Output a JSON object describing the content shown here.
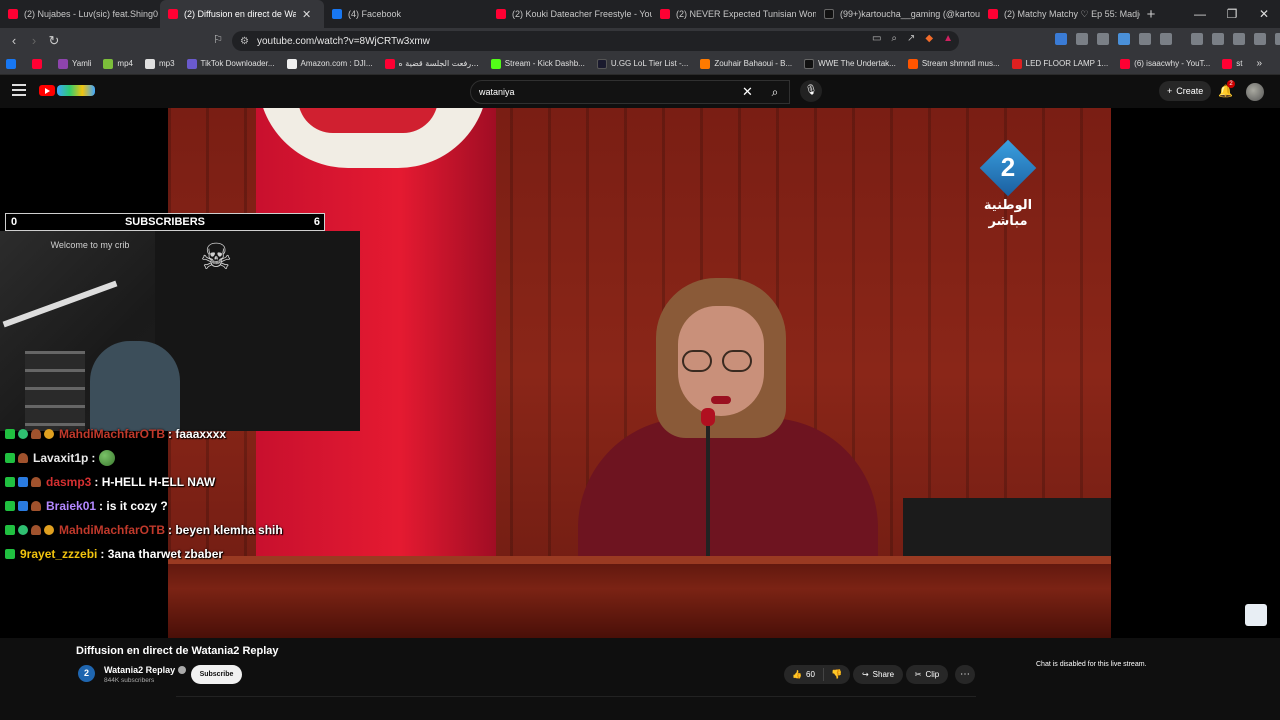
{
  "browser": {
    "tabs": [
      {
        "title": "(2) Nujabes - Luv(sic) feat.Shing0",
        "color": "#ff0033",
        "active": false
      },
      {
        "title": "(2) Diffusion en direct de Wat",
        "color": "#ff0033",
        "active": true
      },
      {
        "title": "(4) Facebook",
        "color": "#1877f2",
        "active": false
      },
      {
        "title": "(2) Kouki Dateacher Freestyle - YouT",
        "color": "#ff0033",
        "active": false
      },
      {
        "title": "(2) NEVER Expected Tunisian Woman",
        "color": "#ff0033",
        "active": false
      },
      {
        "title": "(99+)kartoucha__gaming (@kartouc",
        "color": "#111111",
        "active": false
      },
      {
        "title": "(2) Matchy Matchy ♡ Ep 55: Madjo",
        "color": "#ff0033",
        "active": false
      }
    ],
    "url": "youtube.com/watch?v=8WjCRTw3xmw",
    "bookmarks": [
      {
        "label": "",
        "color": "#1877f2"
      },
      {
        "label": "",
        "color": "#ff0033"
      },
      {
        "label": "Yamli",
        "color": "#8e44ad"
      },
      {
        "label": "mp4",
        "color": "#7cbf3a"
      },
      {
        "label": "mp3",
        "color": "#e0e0e0"
      },
      {
        "label": "TikTok Downloader...",
        "color": "#6a5acd"
      },
      {
        "label": "Amazon.com : DJI...",
        "color": "#f0f0f0"
      },
      {
        "label": "رفعت الجلسة قضية ه...",
        "color": "#ff0033"
      },
      {
        "label": "Stream - Kick Dashb...",
        "color": "#53fc18"
      },
      {
        "label": "U.GG LoL Tier List -...",
        "color": "#1a1a2e"
      },
      {
        "label": "Zouhair Bahaoui - B...",
        "color": "#ff7a00"
      },
      {
        "label": "WWE The Undertak...",
        "color": "#111111"
      },
      {
        "label": "Stream shmndl mus...",
        "color": "#ff5500"
      },
      {
        "label": "LED FLOOR LAMP 1...",
        "color": "#e02020"
      },
      {
        "label": "(6) isaacwhy - YouT...",
        "color": "#ff0033"
      },
      {
        "label": "st",
        "color": "#ff0033"
      }
    ]
  },
  "youtube": {
    "search_value": "wataniya",
    "create_label": "Create",
    "notifications": "2"
  },
  "overlay": {
    "subs_min": "0",
    "subs_label": "SUBSCRIBERS",
    "subs_max": "6",
    "cam_sign": "Welcome to my crib"
  },
  "tv_logo": {
    "number": "2",
    "line1": "الوطنية",
    "line2": "مباشر"
  },
  "chat": [
    {
      "user": "MahdiMachfarOTB",
      "color": "#c0392b",
      "msg": ": faaaxxxx",
      "emote": false
    },
    {
      "user": "Lavaxit1p",
      "color": "#e8e8e8",
      "msg": ":",
      "emote": true
    },
    {
      "user": "dasmp3",
      "color": "#d63031",
      "msg": ": H-HELL H-ELL NAW",
      "emote": false
    },
    {
      "user": "Braiek01",
      "color": "#b388ff",
      "msg": ": is it cozy ?",
      "emote": false
    },
    {
      "user": "MahdiMachfarOTB",
      "color": "#c0392b",
      "msg": ": beyen klemha shih",
      "emote": false
    },
    {
      "user": "9rayet_zzzebi",
      "color": "#f1c40f",
      "msg": ": 3ana tharwet zbaber",
      "emote": false
    }
  ],
  "video": {
    "title": "Diffusion en direct de Watania2 Replay",
    "channel": "Watania2 Replay",
    "subscribers": "844K subscribers",
    "subscribe_label": "Subscribe",
    "likes": "60",
    "share_label": "Share",
    "clip_label": "Clip",
    "chat_disabled": "Chat is disabled for this live stream."
  }
}
